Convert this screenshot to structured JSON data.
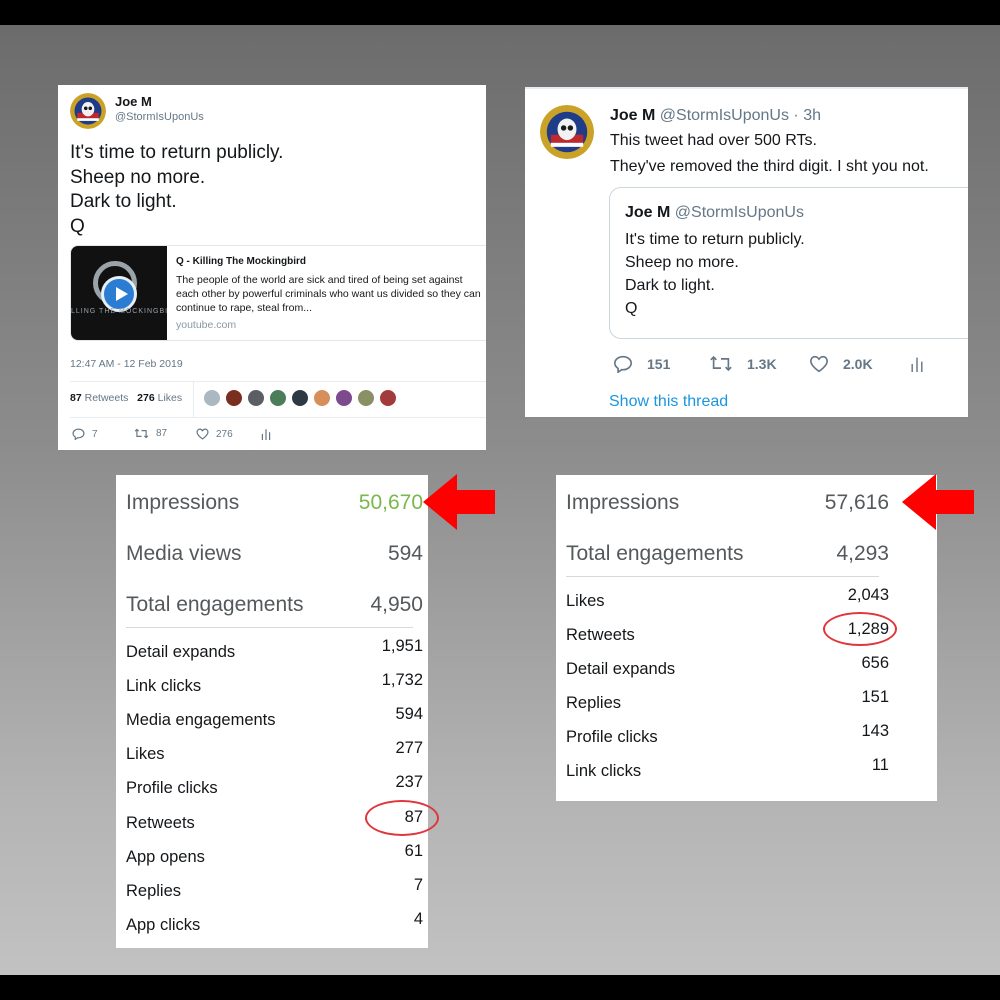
{
  "tweet1": {
    "name": "Joe M",
    "handle": "@StormIsUponUs",
    "lines": [
      "It's time to return publicly.",
      "Sheep no more.",
      "Dark to light.",
      "Q"
    ],
    "link_card": {
      "thumb_caption": "LLING THE MOCKINGBI",
      "title": "Q - Killing The Mockingbird",
      "description": "The people of the world are sick and tired of being set against each other by powerful criminals who want us divided so they can continue to rape, steal from...",
      "domain": "youtube.com"
    },
    "timestamp": "12:47 AM - 12 Feb 2019",
    "retweets_count": "87",
    "retweets_label": "Retweets",
    "likes_count": "276",
    "likes_label": "Likes",
    "actions": {
      "replies": "7",
      "retweets": "87",
      "likes": "276"
    }
  },
  "tweet2": {
    "name": "Joe M",
    "handle": "@StormIsUponUs",
    "time": "· 3h",
    "lines": [
      "This tweet had over 500 RTs.",
      "They've removed the third digit. I sht you not."
    ],
    "quote": {
      "name": "Joe M",
      "handle": "@StormIsUponUs",
      "lines": [
        "It's time to return publicly.",
        "Sheep no more.",
        "Dark to light.",
        "Q"
      ]
    },
    "actions": {
      "replies": "151",
      "retweets": "1.3K",
      "likes": "2.0K"
    },
    "show_thread": "Show this thread"
  },
  "stats_left": {
    "impressions_label": "Impressions",
    "impressions_value": "50,670",
    "media_views_label": "Media views",
    "media_views_value": "594",
    "total_label": "Total engagements",
    "total_value": "4,950",
    "rows": [
      {
        "label": "Detail expands",
        "value": "1,951"
      },
      {
        "label": "Link clicks",
        "value": "1,732"
      },
      {
        "label": "Media engagements",
        "value": "594"
      },
      {
        "label": "Likes",
        "value": "277"
      },
      {
        "label": "Profile clicks",
        "value": "237"
      },
      {
        "label": "Retweets",
        "value": "87"
      },
      {
        "label": "App opens",
        "value": "61"
      },
      {
        "label": "Replies",
        "value": "7"
      },
      {
        "label": "App clicks",
        "value": "4"
      }
    ]
  },
  "stats_right": {
    "impressions_label": "Impressions",
    "impressions_value": "57,616",
    "total_label": "Total engagements",
    "total_value": "4,293",
    "rows": [
      {
        "label": "Likes",
        "value": "2,043"
      },
      {
        "label": "Retweets",
        "value": "1,289"
      },
      {
        "label": "Detail expands",
        "value": "656"
      },
      {
        "label": "Replies",
        "value": "151"
      },
      {
        "label": "Profile clicks",
        "value": "143"
      },
      {
        "label": "Link clicks",
        "value": "11"
      }
    ]
  },
  "colors": {
    "impressions_green": "#79b84a",
    "highlight_red": "#e0353b",
    "arrow_red": "#ff0000",
    "link_blue": "#1b95e0"
  }
}
